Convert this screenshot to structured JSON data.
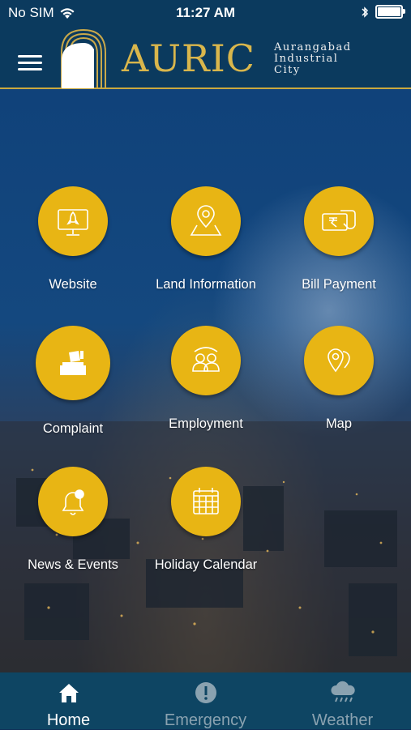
{
  "status_bar": {
    "carrier": "No SIM",
    "time": "11:27 AM"
  },
  "header": {
    "logo_text": "AURIC",
    "logo_subtitle": [
      "Aurangabad",
      "Industrial",
      "City"
    ]
  },
  "menu": {
    "tiles": [
      {
        "label": "Website",
        "icon": "rocket-laptop-icon"
      },
      {
        "label": "Land Information",
        "icon": "location-map-icon"
      },
      {
        "label": "Bill Payment",
        "icon": "rupee-card-icon"
      },
      {
        "label": "Complaint",
        "icon": "ballot-box-icon"
      },
      {
        "label": "Employment",
        "icon": "people-icon"
      },
      {
        "label": "Map",
        "icon": "map-pins-icon"
      },
      {
        "label": "News & Events",
        "icon": "bell-icon"
      },
      {
        "label": "Holiday Calendar",
        "icon": "calendar-icon"
      }
    ]
  },
  "tabbar": {
    "tabs": [
      {
        "label": "Home",
        "icon": "home-icon",
        "active": true
      },
      {
        "label": "Emergency",
        "icon": "alert-icon",
        "active": false
      },
      {
        "label": "Weather",
        "icon": "rain-cloud-icon",
        "active": false
      }
    ]
  },
  "colors": {
    "accent": "#e8b514",
    "header": "#0b3a5e",
    "tabbar": "#0e4563",
    "gold": "#d9b64c"
  }
}
